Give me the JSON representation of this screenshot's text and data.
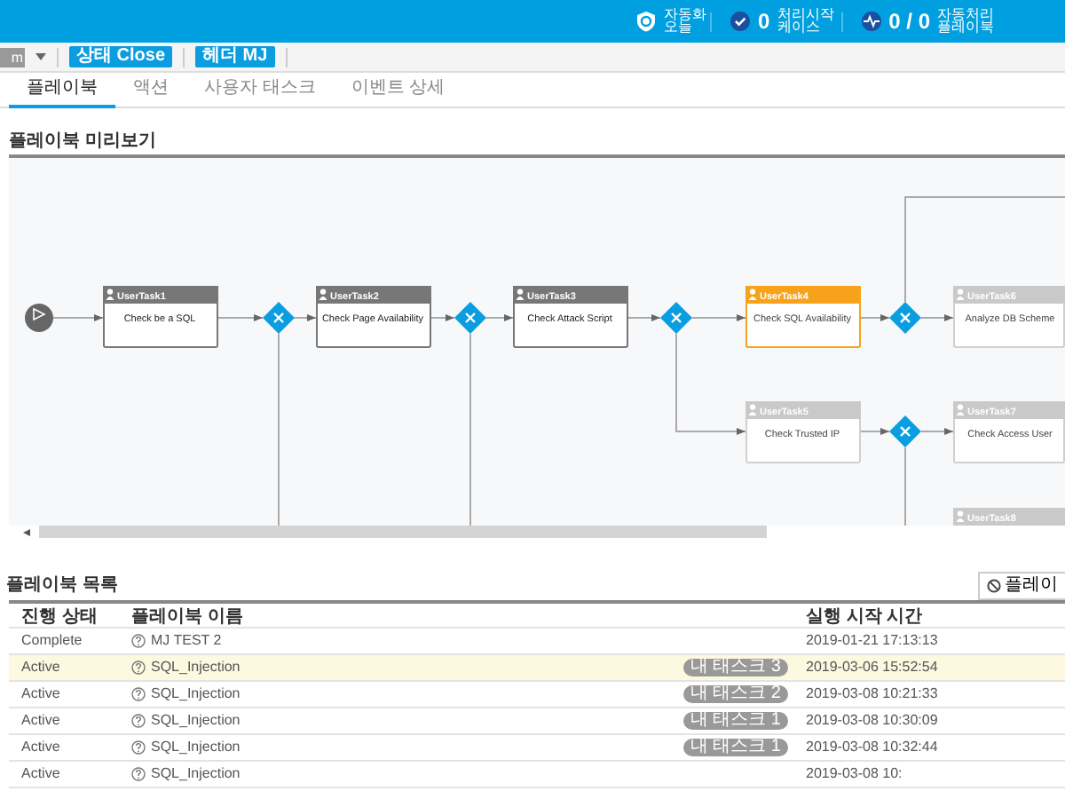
{
  "header": {
    "stats": [
      {
        "label_lines": [
          "자동화",
          "오늘"
        ]
      },
      {
        "value": "0",
        "label_lines": [
          "처리시작",
          "케이스"
        ]
      },
      {
        "value": "0 / 0",
        "label_lines": [
          "자동처리",
          "플레이북"
        ]
      }
    ]
  },
  "toolbar": {
    "dropdown_text": "m",
    "buttons": [
      "상태 Close",
      "헤더 MJ"
    ]
  },
  "tabs": [
    {
      "label": "플레이북",
      "selected": true
    },
    {
      "label": "액션",
      "selected": false
    },
    {
      "label": "사용자 태스크",
      "selected": false
    },
    {
      "label": "이벤트 상세",
      "selected": false
    }
  ],
  "preview": {
    "title": "플레이북 미리보기",
    "nodes": [
      {
        "kind": "start"
      },
      {
        "kind": "task",
        "title": "UserTask1",
        "label": "Check be a SQL",
        "done": true,
        "current": false
      },
      {
        "kind": "gateway"
      },
      {
        "kind": "task",
        "title": "UserTask2",
        "label": "Check Page Availability",
        "done": true,
        "current": false
      },
      {
        "kind": "gateway"
      },
      {
        "kind": "task",
        "title": "UserTask3",
        "label": "Check Attack Script",
        "done": true,
        "current": false
      },
      {
        "kind": "gateway"
      },
      {
        "kind": "task",
        "title": "UserTask4",
        "label": "Check SQL Availability",
        "done": false,
        "current": true
      },
      {
        "kind": "gateway"
      },
      {
        "kind": "task",
        "title": "UserTask6",
        "label": "Analyze DB Scheme",
        "done": false,
        "current": false
      },
      {
        "kind": "task",
        "title": "UserTask5",
        "label": "Check Trusted IP",
        "done": false,
        "current": false
      },
      {
        "kind": "gateway"
      },
      {
        "kind": "task",
        "title": "UserTask7",
        "label": "Check Access User",
        "done": false,
        "current": false
      },
      {
        "kind": "task",
        "title": "UserTask8",
        "done": false,
        "current": false
      }
    ]
  },
  "list": {
    "title": "플레이북 목록",
    "action_button": "플레이",
    "columns": [
      "진행 상태",
      "플레이북 이름",
      "실행 시작 시간"
    ],
    "rows": [
      {
        "status": "Complete",
        "name": "MJ TEST 2",
        "time": "2019-01-21 17:13:13",
        "selected": false
      },
      {
        "status": "Active",
        "name": "SQL_Injection",
        "badge": "내 태스크 3",
        "time": "2019-03-06 15:52:54",
        "selected": true
      },
      {
        "status": "Active",
        "name": "SQL_Injection",
        "badge": "내 태스크 2",
        "time": "2019-03-08 10:21:33",
        "selected": false
      },
      {
        "status": "Active",
        "name": "SQL_Injection",
        "badge": "내 태스크 1",
        "time": "2019-03-08 10:30:09",
        "selected": false
      },
      {
        "status": "Active",
        "name": "SQL_Injection",
        "badge": "내 태스크 1",
        "time": "2019-03-08 10:32:44",
        "selected": false
      },
      {
        "status": "Active",
        "name": "SQL_Injection",
        "time": "2019-03-08 10:",
        "selected": false
      }
    ]
  }
}
